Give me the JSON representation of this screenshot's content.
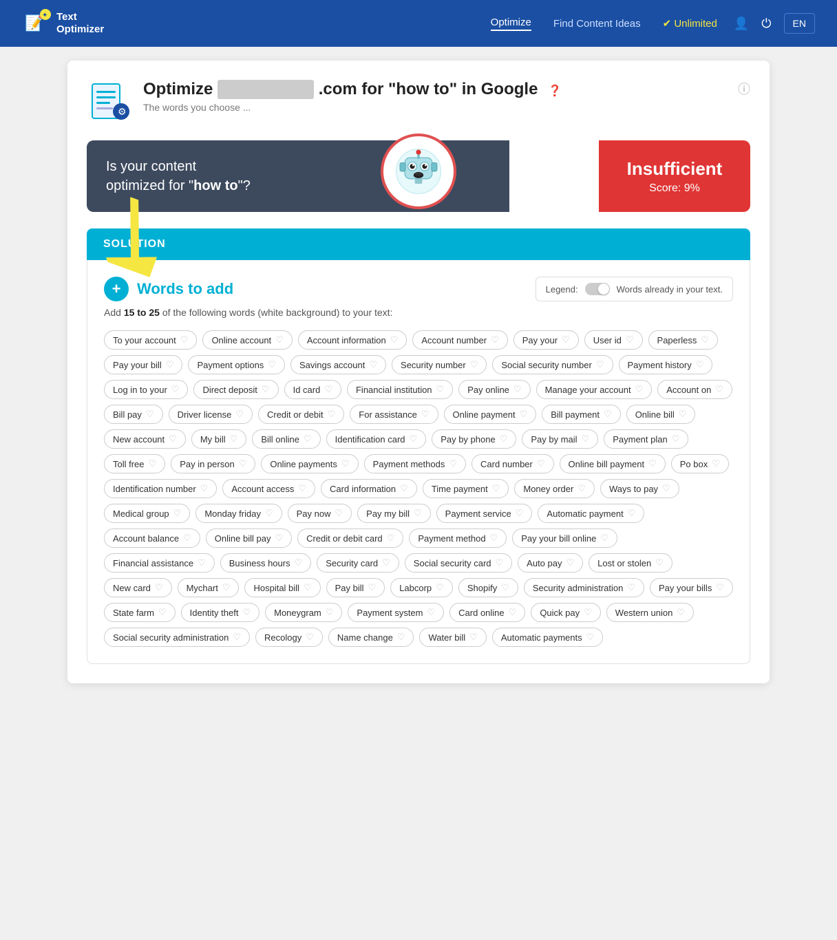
{
  "nav": {
    "logo_line1": "Text",
    "logo_line2": "Optimizer",
    "links": [
      {
        "label": "Optimize",
        "active": true
      },
      {
        "label": "Find Content Ideas",
        "active": false
      }
    ],
    "unlimited": "✔ Unlimited",
    "lang": "EN"
  },
  "page": {
    "title_prefix": "Optimize",
    "title_blurred": "            ",
    "title_suffix": ".com for \"how to\" in Google",
    "subtitle": "The words you choose ...",
    "info_icon": "ⓘ"
  },
  "score_card": {
    "question_prefix": "Is your content optimized for \"",
    "question_keyword": "how to",
    "question_suffix": "\"?",
    "result_label": "Insufficient",
    "result_score": "Score: 9%"
  },
  "solution": {
    "section_label": "SOLUTION",
    "words_title": "Words to add",
    "legend_label": "Legend:",
    "legend_text": "Words already in your text.",
    "instruction_prefix": "Add ",
    "instruction_range": "15 to 25",
    "instruction_suffix": " of the following words (white background) to your text:"
  },
  "tags": [
    "To your account",
    "Online account",
    "Account information",
    "Account number",
    "Pay your",
    "User id",
    "Paperless",
    "Pay your bill",
    "Payment options",
    "Savings account",
    "Security number",
    "Social security number",
    "Payment history",
    "Log in to your",
    "Direct deposit",
    "Id card",
    "Financial institution",
    "Pay online",
    "Manage your account",
    "Account on",
    "Bill pay",
    "Driver license",
    "Credit or debit",
    "For assistance",
    "Online payment",
    "Bill payment",
    "Online bill",
    "New account",
    "My bill",
    "Bill online",
    "Identification card",
    "Pay by phone",
    "Pay by mail",
    "Payment plan",
    "Toll free",
    "Pay in person",
    "Online payments",
    "Payment methods",
    "Card number",
    "Online bill payment",
    "Po box",
    "Identification number",
    "Account access",
    "Card information",
    "Time payment",
    "Money order",
    "Ways to pay",
    "Medical group",
    "Monday friday",
    "Pay now",
    "Pay my bill",
    "Payment service",
    "Automatic payment",
    "Account balance",
    "Online bill pay",
    "Credit or debit card",
    "Payment method",
    "Pay your bill online",
    "Financial assistance",
    "Business hours",
    "Security card",
    "Social security card",
    "Auto pay",
    "Lost or stolen",
    "New card",
    "Mychart",
    "Hospital bill",
    "Pay bill",
    "Labcorp",
    "Shopify",
    "Security administration",
    "Pay your bills",
    "State farm",
    "Identity theft",
    "Moneygram",
    "Payment system",
    "Card online",
    "Quick pay",
    "Western union",
    "Social security administration",
    "Recology",
    "Name change",
    "Water bill",
    "Automatic payments"
  ]
}
